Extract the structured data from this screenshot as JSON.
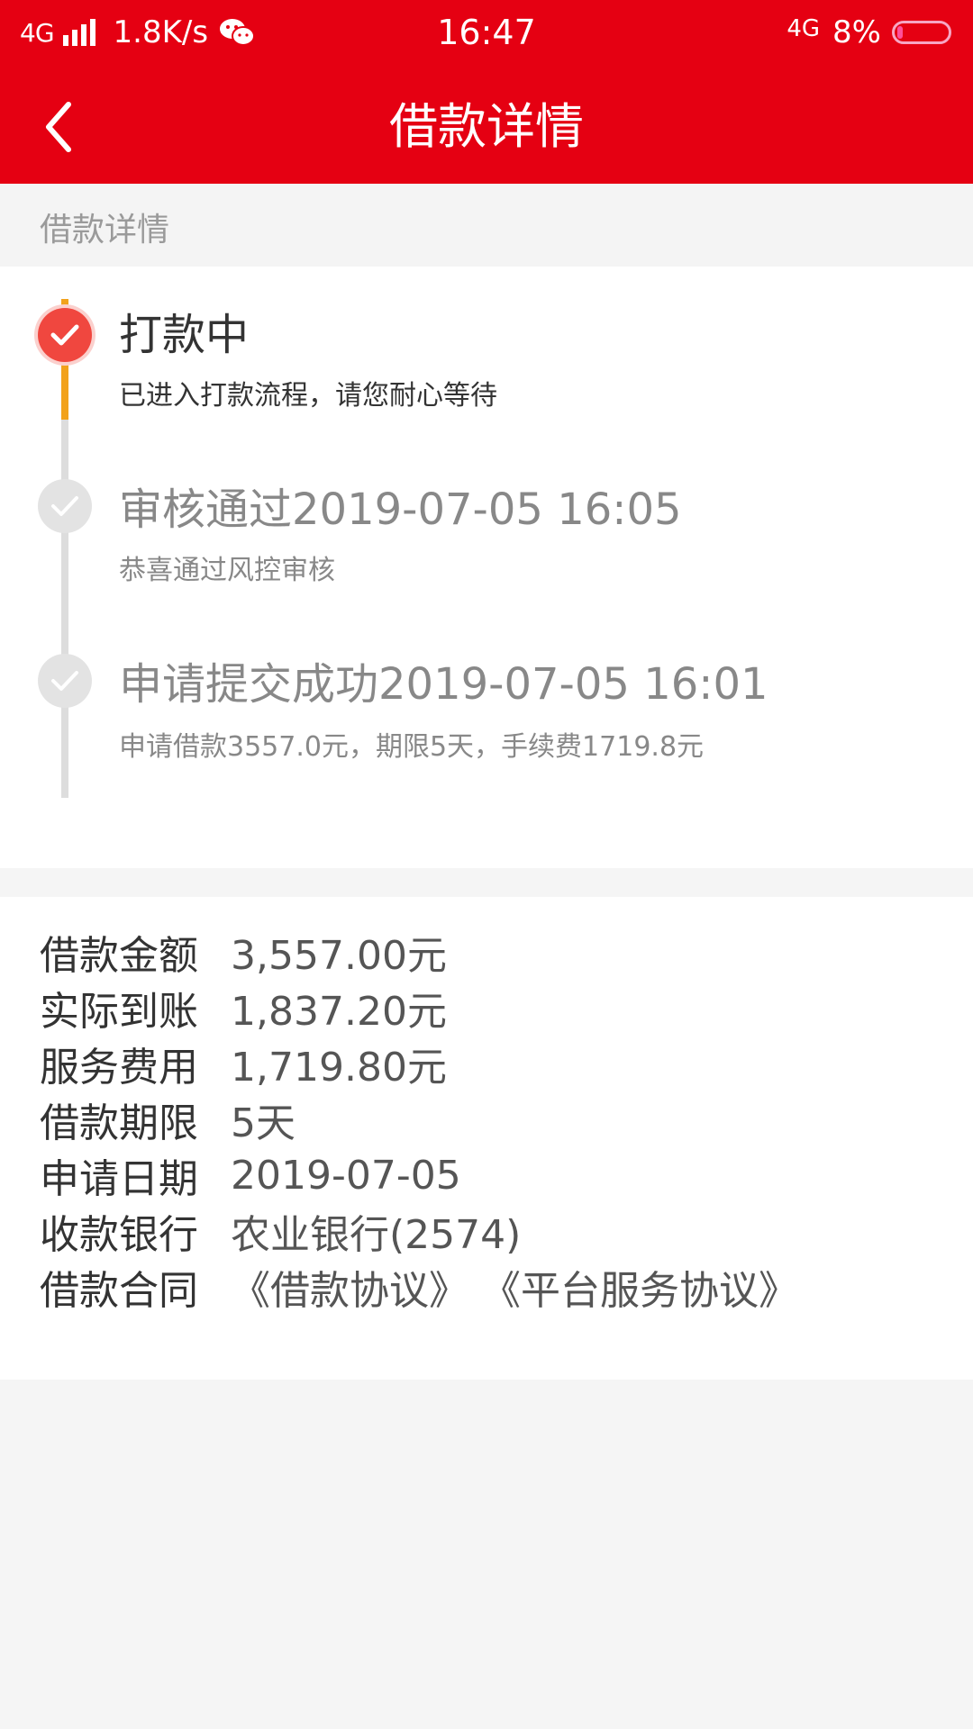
{
  "status_bar": {
    "network": "4G",
    "speed": "1.8K/s",
    "time": "16:47",
    "network2": "4G",
    "battery": "8%",
    "icons": [
      "signal-icon",
      "wechat-icon",
      "battery-icon"
    ]
  },
  "nav": {
    "title": "借款详情",
    "back_icon": "chevron-left-icon"
  },
  "section_header": "借款详情",
  "timeline": [
    {
      "title": "打款中",
      "desc": "已进入打款流程，请您耐心等待",
      "active": true
    },
    {
      "title": "审核通过2019-07-05 16:05",
      "desc": "恭喜通过风控审核",
      "active": false
    },
    {
      "title": "申请提交成功2019-07-05 16:01",
      "desc": "申请借款3557.0元，期限5天，手续费1719.8元",
      "active": false
    }
  ],
  "details": [
    {
      "label": "借款金额",
      "value": "3,557.00元"
    },
    {
      "label": "实际到账",
      "value": "1,837.20元"
    },
    {
      "label": "服务费用",
      "value": "1,719.80元"
    },
    {
      "label": "借款期限",
      "value": "5天"
    },
    {
      "label": "申请日期",
      "value": "2019-07-05"
    },
    {
      "label": "收款银行",
      "value": "农业银行(2574)"
    }
  ],
  "contract": {
    "label": "借款合同",
    "links": [
      "《借款协议》",
      "《平台服务协议》"
    ]
  },
  "colors": {
    "brand_red": "#e50012",
    "active_dot": "#f0473f",
    "active_line": "#f2a21c",
    "inactive": "#dddddd"
  }
}
